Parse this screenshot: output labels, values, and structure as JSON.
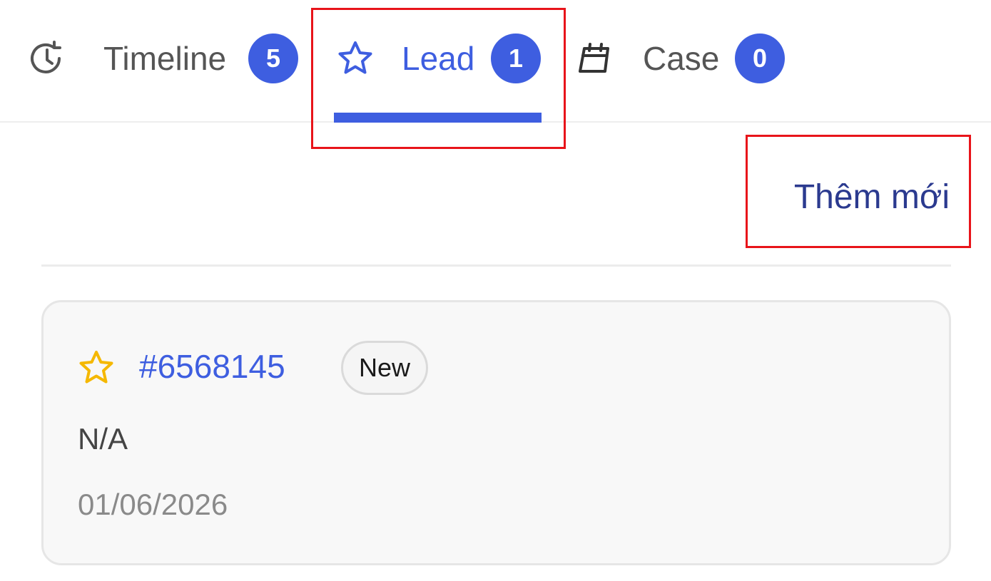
{
  "tabs": {
    "timeline": {
      "label": "Timeline",
      "count": "5",
      "icon": "history-icon"
    },
    "lead": {
      "label": "Lead",
      "count": "1",
      "icon": "star-icon",
      "active": true
    },
    "case": {
      "label": "Case",
      "count": "0",
      "icon": "calendar-icon"
    }
  },
  "actions": {
    "add_new_label": "Thêm mới"
  },
  "leads": [
    {
      "id": "#6568145",
      "status": "New",
      "name": "N/A",
      "date": "01/06/2026",
      "icon": "star-icon"
    }
  ],
  "colors": {
    "accent": "#3e5ee0",
    "link_dark": "#2b3a8f",
    "star_yellow": "#f5b800",
    "highlight_red": "#e8141a"
  }
}
